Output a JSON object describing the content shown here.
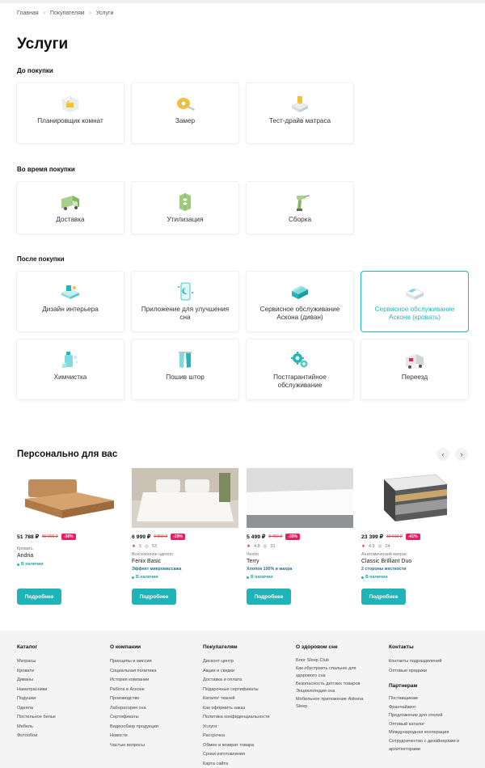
{
  "breadcrumb": [
    "Главная",
    "Покупателям",
    "Услуги"
  ],
  "page_title": "Услуги",
  "sections": {
    "before": "До покупки",
    "during": "Во время покупки",
    "after": "После покупки"
  },
  "services": {
    "before": [
      {
        "label": "Планировщик комнат",
        "icon": "room-planner-icon"
      },
      {
        "label": "Замер",
        "icon": "tape-measure-icon"
      },
      {
        "label": "Тест-драйв матраса",
        "icon": "mattress-test-icon"
      }
    ],
    "during": [
      {
        "label": "Доставка",
        "icon": "delivery-truck-icon"
      },
      {
        "label": "Утилизация",
        "icon": "recycle-icon"
      },
      {
        "label": "Сборка",
        "icon": "drill-icon"
      }
    ],
    "after": [
      {
        "label": "Дизайн интерьера",
        "icon": "interior-design-icon"
      },
      {
        "label": "Приложение для улучшения сна",
        "icon": "sleep-app-icon"
      },
      {
        "label": "Сервисное обслуживание Аскона (диван)",
        "icon": "sofa-service-icon"
      },
      {
        "label": "Сервисное обслуживание Аскона (кровать)",
        "icon": "bed-service-icon"
      },
      {
        "label": "Химчистка",
        "icon": "dry-cleaning-icon"
      },
      {
        "label": "Пошив штор",
        "icon": "curtains-icon"
      },
      {
        "label": "Постгарантийное обслуживание",
        "icon": "gears-icon"
      },
      {
        "label": "Переезд",
        "icon": "moving-van-icon"
      }
    ]
  },
  "personal": {
    "title": "Персонально для вас",
    "button_label": "Подробнее",
    "products": [
      {
        "price": "51 788 ₽",
        "old_price": "80 000 ₽",
        "discount": "-36%",
        "rating": "",
        "reviews": "",
        "category": "Кровать",
        "name": "Andria",
        "feature": "",
        "stock": "В наличии"
      },
      {
        "price": "6 999 ₽",
        "old_price": "9 860 ₽",
        "discount": "-29%",
        "rating": "5",
        "reviews": "53",
        "category": "Всесезонное одеяло",
        "name": "Fenix Basic",
        "feature": "Эффект микромассажа",
        "stock": "В наличии"
      },
      {
        "price": "5 499 ₽",
        "old_price": "8 460 ₽",
        "discount": "-35%",
        "rating": "4.8",
        "reviews": "31",
        "category": "Чехол",
        "name": "Terry",
        "feature": "Хлопок 100% и махра",
        "stock": "В наличии"
      },
      {
        "price": "23 399 ₽",
        "old_price": "32 610 ₽",
        "discount": "-41%",
        "rating": "4.9",
        "reviews": "24",
        "category": "Анатомический матрас",
        "name": "Classic Brilliant Duo",
        "feature": "2 стороны жесткости",
        "stock": "В наличии"
      }
    ]
  },
  "footer": {
    "catalog": {
      "title": "Каталог",
      "links": [
        "Матрасы",
        "Кровати",
        "Диваны",
        "Наматрасники",
        "Подушки",
        "Одеяла",
        "Постельное белье",
        "Мебель",
        "Фотообои"
      ]
    },
    "company": {
      "title": "О компании",
      "links": [
        "Принципы и миссия",
        "Социальная политика",
        "История компании",
        "Работа в Асконе",
        "Производство",
        "Лаборатория сна",
        "Сертификаты",
        "Видеообзор продукции",
        "Новости",
        "Частые вопросы"
      ]
    },
    "buyers": {
      "title": "Покупателям",
      "links": [
        "Дисконт-центр",
        "Акции и скидки",
        "Доставка и оплата",
        "Подарочные сертификаты",
        "Каталог тканей",
        "Как оформить заказ",
        "Политика конфиденциальности",
        "Услуги",
        "Рассрочка",
        "Обмен и возврат товара",
        "Сроки изготовления",
        "Карта сайта"
      ]
    },
    "health": {
      "title": "О здоровом сне",
      "links": [
        "Блог Sleep Club",
        "Как обустроить спальню для здорового сна",
        "Безопасность детских товаров",
        "Энциклопедия сна",
        "Мобильное приложение Askona Sleep"
      ]
    },
    "contacts": {
      "title": "Контакты",
      "links": [
        "Контакты подразделений",
        "Оптовые продажи"
      ]
    },
    "partners": {
      "title": "Партнерам",
      "links": [
        "Поставщикам",
        "Франчайзинг",
        "Предложение для отелей",
        "Оптовый каталог",
        "Международная кооперация",
        "Сотрудничество с дизайнерами и архитекторами"
      ]
    }
  }
}
